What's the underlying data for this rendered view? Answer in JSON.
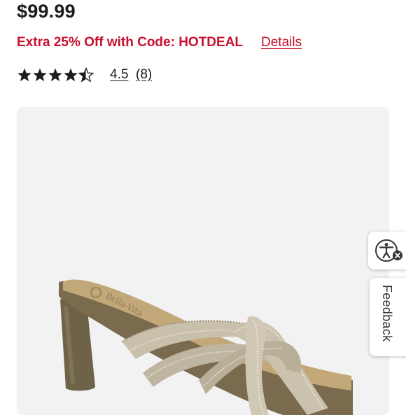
{
  "product": {
    "price": "$99.99",
    "promo_text": "Extra 25% Off with Code: HOTDEAL",
    "promo_details_label": "Details",
    "rating": 4.5,
    "rating_value_label": "4.5",
    "rating_count_label": "(8)",
    "image": {
      "icon": "product-photo-sandal",
      "brand_on_insole": "Bella-Vita"
    }
  },
  "widgets": {
    "accessibility_icon": "accessibility-person-icon",
    "feedback_label": "Feedback"
  },
  "colors": {
    "promo_red": "#c8102e",
    "star_fill": "#1b1b1b",
    "image_background": "#f2f2f2"
  }
}
